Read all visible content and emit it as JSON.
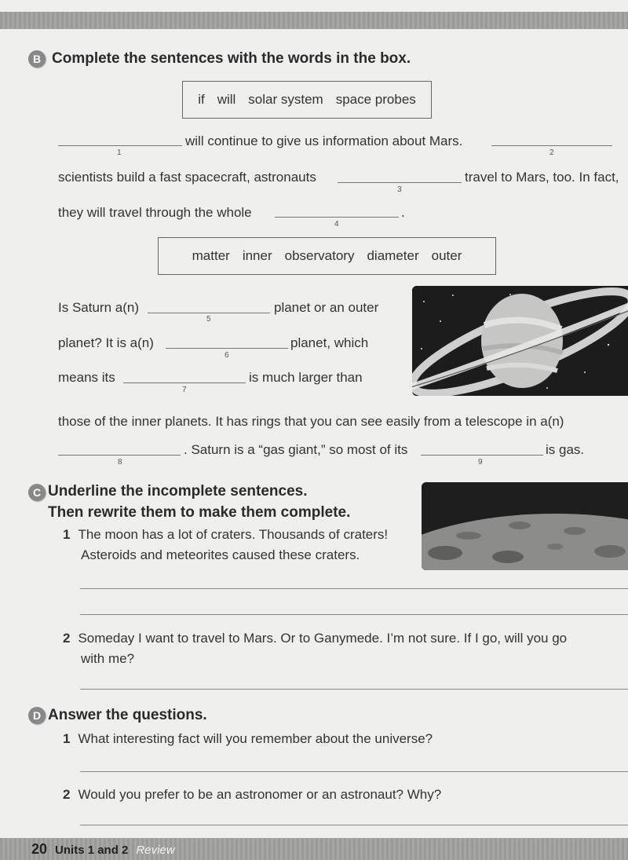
{
  "footer": {
    "page": "20",
    "units": "Units 1 and 2",
    "section": "Review"
  },
  "sectionB": {
    "badge": "B",
    "title": "Complete the sentences with the words in the box.",
    "box1": [
      "if",
      "will",
      "solar system",
      "space probes"
    ],
    "line1": "will continue to give us information about Mars.",
    "line2a": "scientists build a fast spacecraft, astronauts",
    "line2b": "travel to Mars, too. In fact,",
    "line3a": "they will travel through the whole",
    "line3b": ".",
    "box2": [
      "matter",
      "inner",
      "observatory",
      "diameter",
      "outer"
    ],
    "s5a": "Is Saturn a(n)",
    "s5b": "planet or an outer",
    "s6a": "planet? It is a(n)",
    "s6b": "planet, which",
    "s7a": "means its",
    "s7b": "is much larger than",
    "s8": "those of the inner planets. It has rings that you can see easily from a telescope in a(n)",
    "s9a": ". Saturn is a “gas giant,” so most of its",
    "s9b": "is gas.",
    "blank_numbers": [
      "1",
      "2",
      "3",
      "4",
      "5",
      "6",
      "7",
      "8",
      "9"
    ],
    "image": "saturn-illustration"
  },
  "sectionC": {
    "badge": "C",
    "title_line1": "Underline the incomplete sentences.",
    "title_line2": "Then rewrite them to make them complete.",
    "items": [
      {
        "num": "1",
        "line1": "The moon has a lot of craters. Thousands of craters!",
        "line2": "Asteroids and meteorites caused these craters."
      },
      {
        "num": "2",
        "line1": "Someday I want to travel to Mars. Or to Ganymede. I’m not sure. If I go, will you go",
        "line2": "with me?"
      }
    ],
    "image": "moon-surface-illustration"
  },
  "sectionD": {
    "badge": "D",
    "title": "Answer the questions.",
    "items": [
      {
        "num": "1",
        "text": "What interesting fact will you remember about the universe?"
      },
      {
        "num": "2",
        "text": "Would you prefer to be an astronomer or an astronaut? Why?"
      }
    ]
  }
}
